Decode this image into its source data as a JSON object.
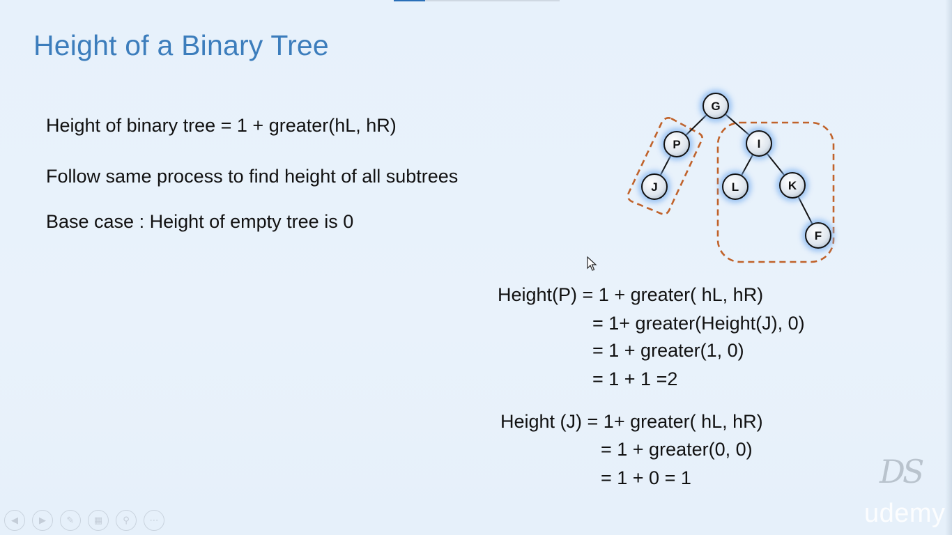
{
  "slide": {
    "title": "Height of a Binary Tree",
    "bullets": [
      "Height of binary tree = 1 + greater(hL, hR)",
      "Follow same process to find height of all subtrees",
      "Base case : Height of empty tree is 0"
    ],
    "height_p": {
      "line1": "Height(P) = 1 + greater( hL, hR)",
      "line2": "= 1+ greater(Height(J), 0)",
      "line3": "= 1 + greater(1, 0)",
      "line4": "= 1 + 1 =2"
    },
    "height_j": {
      "line1": "Height (J) = 1+ greater( hL, hR)",
      "line2": "= 1 + greater(0, 0)",
      "line3": "= 1 + 0 = 1"
    }
  },
  "tree": {
    "nodes": [
      "G",
      "P",
      "I",
      "J",
      "L",
      "K",
      "F"
    ],
    "edges": [
      [
        "G",
        "P"
      ],
      [
        "G",
        "I"
      ],
      [
        "P",
        "J"
      ],
      [
        "I",
        "L"
      ],
      [
        "I",
        "K"
      ],
      [
        "K",
        "F"
      ]
    ],
    "node_glow_color": "#7fb2f0",
    "dashed_box_color": "#c0622a"
  },
  "player": {
    "progress_fraction": 0.19,
    "controls": [
      "previous-icon",
      "next-icon",
      "pen-icon",
      "slides-icon",
      "zoom-icon",
      "more-icon"
    ]
  },
  "branding": {
    "logo_text": "DS",
    "watermark": "udemy"
  },
  "colors": {
    "title": "#3c7dbc",
    "background": "#e8f1fb",
    "text": "#111111"
  }
}
